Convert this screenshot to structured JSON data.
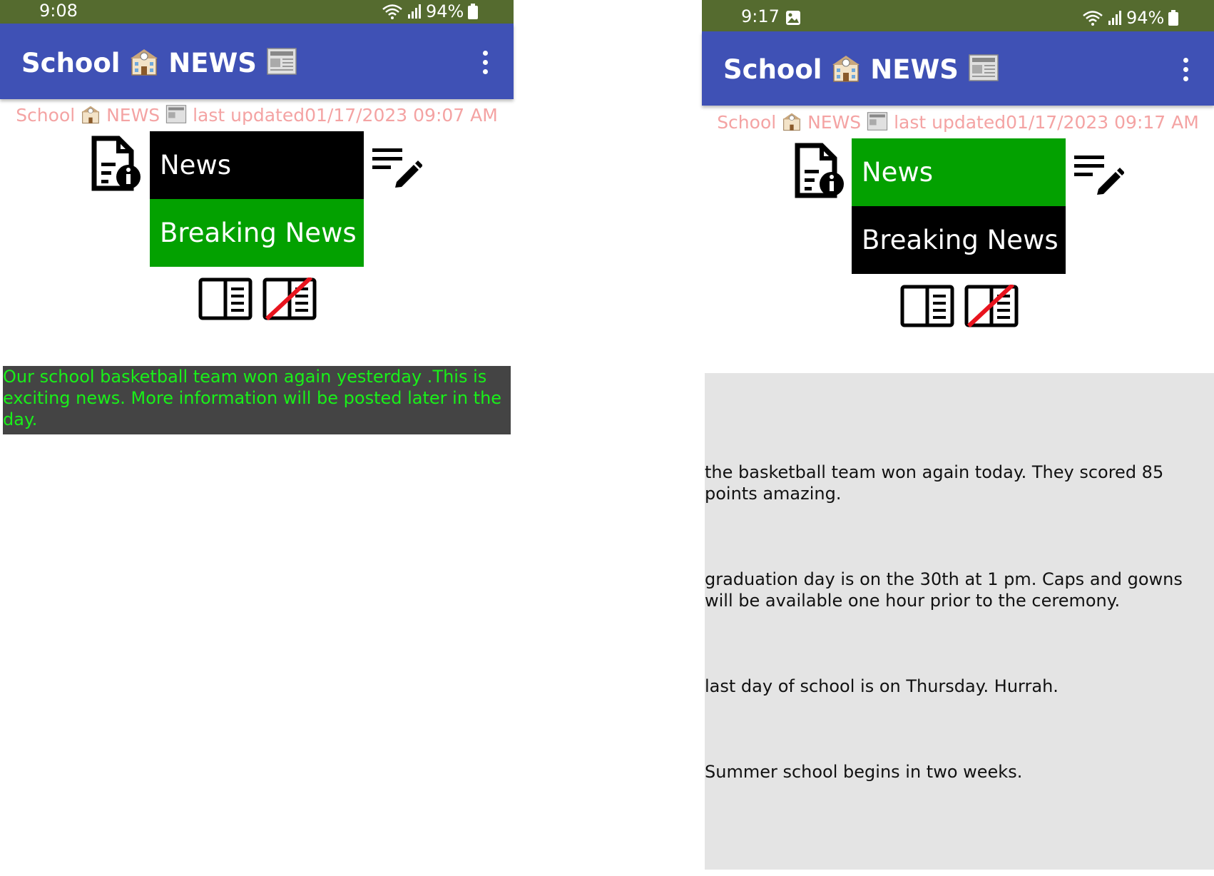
{
  "left_screen": {
    "status": {
      "time": "9:08",
      "battery": "94%"
    },
    "app_title": {
      "school": "School",
      "news": "NEWS"
    },
    "updated": {
      "school": "School",
      "news": "NEWS",
      "text": "last updated01/17/2023 09:07 AM"
    },
    "tabs": {
      "news": "News",
      "breaking": "Breaking News"
    },
    "news_text": "Our school basketball team won again yesterday .This is exciting news. More information will be posted later in the day."
  },
  "right_screen": {
    "status": {
      "time": "9:17",
      "battery": "94%"
    },
    "app_title": {
      "school": "School",
      "news": "NEWS"
    },
    "updated": {
      "school": "School",
      "news": "NEWS",
      "text": "last updated01/17/2023 09:17 AM"
    },
    "tabs": {
      "news": "News",
      "breaking": "Breaking News"
    },
    "news_items": [
      "the basketball team won again today. They scored 85 points amazing.",
      "graduation day is on the 30th at 1 pm. Caps and gowns will be available one hour prior to the ceremony.",
      "last day of school is on Thursday.  Hurrah.",
      "Summer school begins in two weeks."
    ]
  },
  "colors": {
    "status_bar": "#556b2f",
    "app_bar": "#3f51b5",
    "active_green": "#03a100",
    "inactive_black": "#000000",
    "updated_text": "#f4a3a3",
    "news_text_green": "#19f019"
  },
  "icons": [
    "wifi-icon",
    "signal-icon",
    "battery-icon",
    "school-emoji-icon",
    "newspaper-emoji-icon",
    "overflow-menu-icon",
    "document-info-icon",
    "edit-list-icon",
    "reader-view-icon",
    "reader-view-off-icon",
    "image-notification-icon"
  ]
}
